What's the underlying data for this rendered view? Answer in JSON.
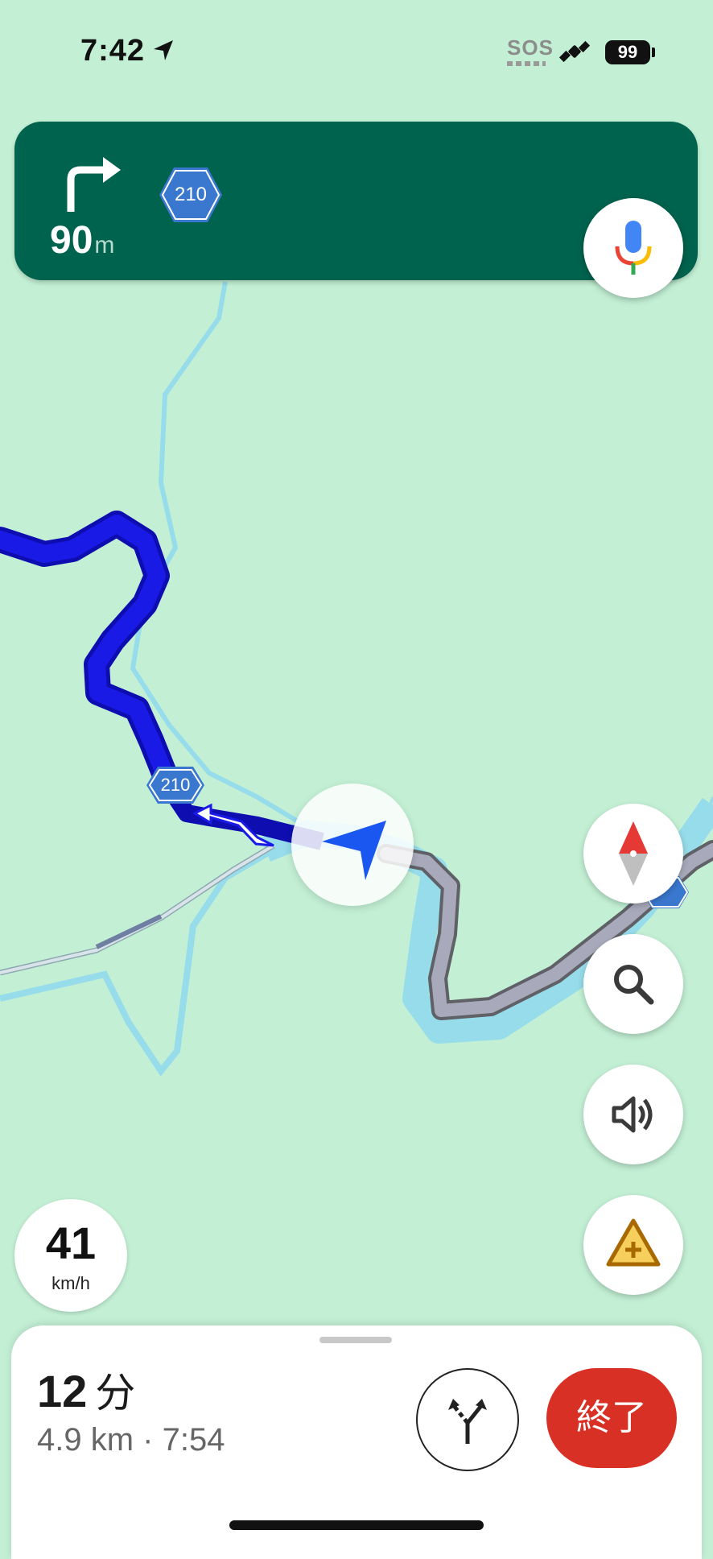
{
  "status_bar": {
    "time": "7:42",
    "sos": "SOS",
    "battery": "99"
  },
  "banner": {
    "distance_value": "90",
    "distance_unit": "m",
    "route_number": "210",
    "turn_direction": "right"
  },
  "map": {
    "route_label": "210"
  },
  "speed": {
    "value": "41",
    "unit": "km/h"
  },
  "sheet": {
    "duration_value": "12",
    "duration_unit": "分",
    "details": "4.9 km · 7:54",
    "end_label": "終了"
  },
  "icons": {
    "turn": "turn-right-icon",
    "mic": "microphone-icon",
    "compass": "compass-icon",
    "search": "search-icon",
    "sound": "speaker-icon",
    "report": "report-incident-icon",
    "alt_routes": "alternate-routes-icon",
    "nav_arrow": "navigation-arrow-icon"
  },
  "colors": {
    "map_bg": "#c3f0d5",
    "water": "#96dcea",
    "route": "#1a1ae6",
    "banner": "#00634d",
    "end_button": "#d93025",
    "shield": "#3a78cf"
  }
}
